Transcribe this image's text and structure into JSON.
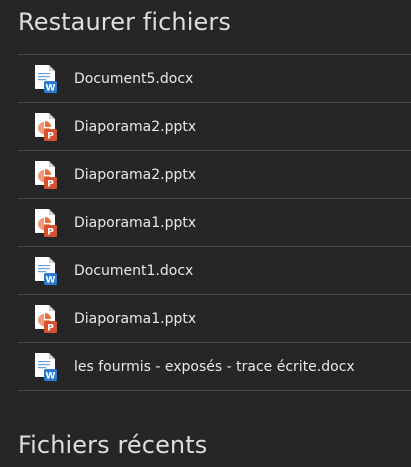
{
  "sections": {
    "restore_title": "Restaurer fichiers",
    "recent_title": "Fichiers récents"
  },
  "files": [
    {
      "name": "Document5.docx",
      "icon": "word-document-icon"
    },
    {
      "name": "Diaporama2.pptx",
      "icon": "powerpoint-presentation-icon"
    },
    {
      "name": "Diaporama2.pptx",
      "icon": "powerpoint-presentation-icon"
    },
    {
      "name": "Diaporama1.pptx",
      "icon": "powerpoint-presentation-icon"
    },
    {
      "name": "Document1.docx",
      "icon": "word-document-icon"
    },
    {
      "name": "Diaporama1.pptx",
      "icon": "powerpoint-presentation-icon"
    },
    {
      "name": "les fourmis - exposés - trace écrite.docx",
      "icon": "word-document-icon"
    }
  ],
  "colors": {
    "background": "#262626",
    "divider": "#4a4a4a",
    "word_accent": "#2b7cd3",
    "powerpoint_accent": "#d35230"
  }
}
